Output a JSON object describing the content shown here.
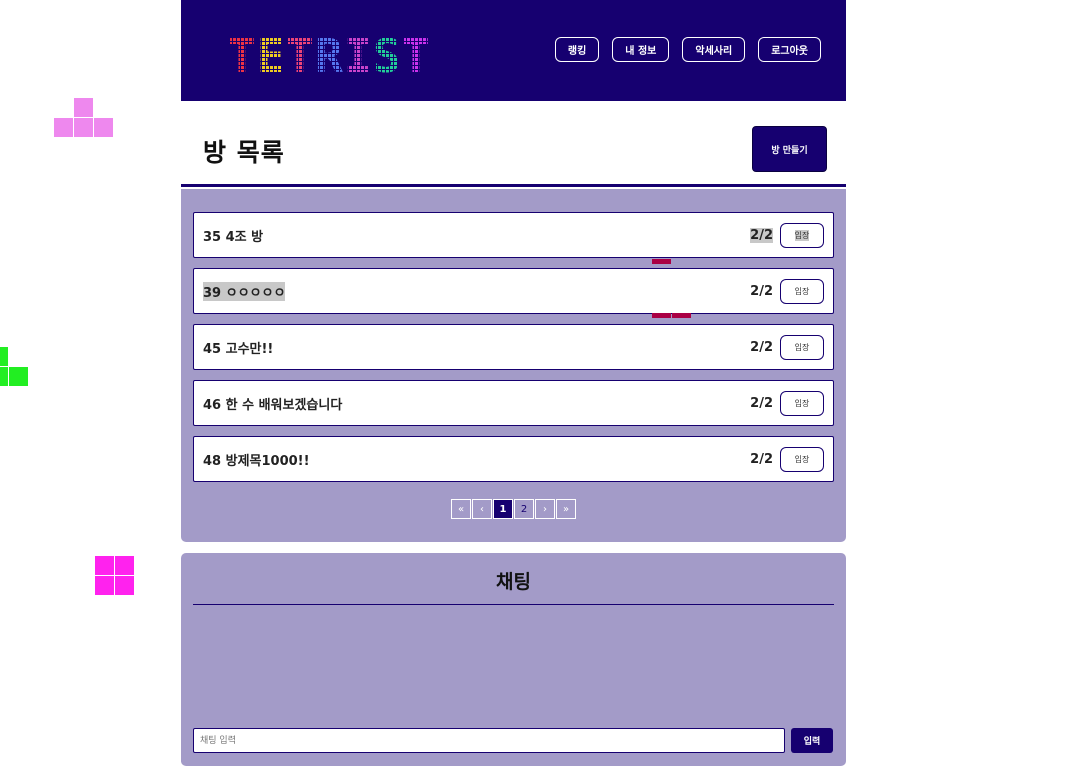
{
  "header": {
    "logo_letters": [
      "T",
      "E",
      "T",
      "R",
      "I",
      "S",
      "T"
    ],
    "logo_colors": [
      "#ee3344",
      "#eecc22",
      "#ee4477",
      "#5577ee",
      "#cc44cc",
      "#22cc99",
      "#cc33ee"
    ],
    "nav": [
      {
        "label": "랭킹"
      },
      {
        "label": "내 정보"
      },
      {
        "label": "악세사리"
      },
      {
        "label": "로그아웃"
      }
    ]
  },
  "page": {
    "title": "방 목록",
    "create_room_label": "방 만들기"
  },
  "rooms": [
    {
      "name": "35 4조 방",
      "count": "2/2",
      "enter_label": "입장"
    },
    {
      "name": "39 ㅇㅇㅇㅇㅇ",
      "count": "2/2",
      "enter_label": "입장"
    },
    {
      "name": "45 고수만!!",
      "count": "2/2",
      "enter_label": "입장"
    },
    {
      "name": "46 한 수 배워보겠습니다",
      "count": "2/2",
      "enter_label": "입장"
    },
    {
      "name": "48 방제목1000!!",
      "count": "2/2",
      "enter_label": "입장"
    }
  ],
  "pagination": {
    "first": "«",
    "prev": "‹",
    "pages": [
      "1",
      "2"
    ],
    "current": "1",
    "next": "›",
    "last": "»"
  },
  "chat": {
    "title": "채팅",
    "input_placeholder": "채팅 입력",
    "send_label": "입력"
  },
  "colors": {
    "primary": "#160070",
    "panel": "#a39bc8",
    "deco_pink": "#ee88ee",
    "deco_green": "#22ee22",
    "deco_magenta": "#ff22ee",
    "deco_red": "#aa0044"
  }
}
